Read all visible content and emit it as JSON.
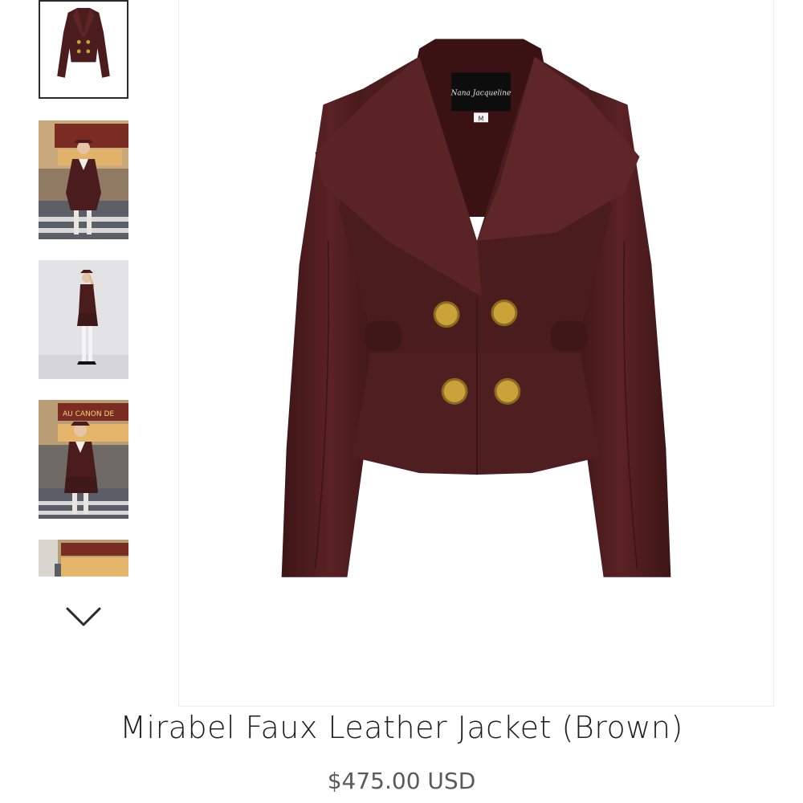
{
  "product": {
    "title": "Mirabel Faux Leather Jacket (Brown)",
    "price": "$475.00 USD"
  },
  "main_image": {
    "label_brand": "Nana Jacqueline",
    "label_size": "M",
    "alt": "Mirabel Faux Leather Jacket (Brown)"
  },
  "gallery": {
    "thumbnails": [
      {
        "label": "jacket-flat",
        "active": true
      },
      {
        "label": "street-front",
        "active": false
      },
      {
        "label": "studio-side",
        "active": false
      },
      {
        "label": "cafe-front",
        "active": false
      },
      {
        "label": "cafe-partial",
        "active": false
      }
    ],
    "sign_text": "AU CANON DE",
    "next_icon": "chevron-down-icon"
  },
  "colors": {
    "leather": "#4a1c1e",
    "leather_light": "#6b2a2c",
    "gold": "#c9a23a",
    "border": "#2b2b2b"
  }
}
